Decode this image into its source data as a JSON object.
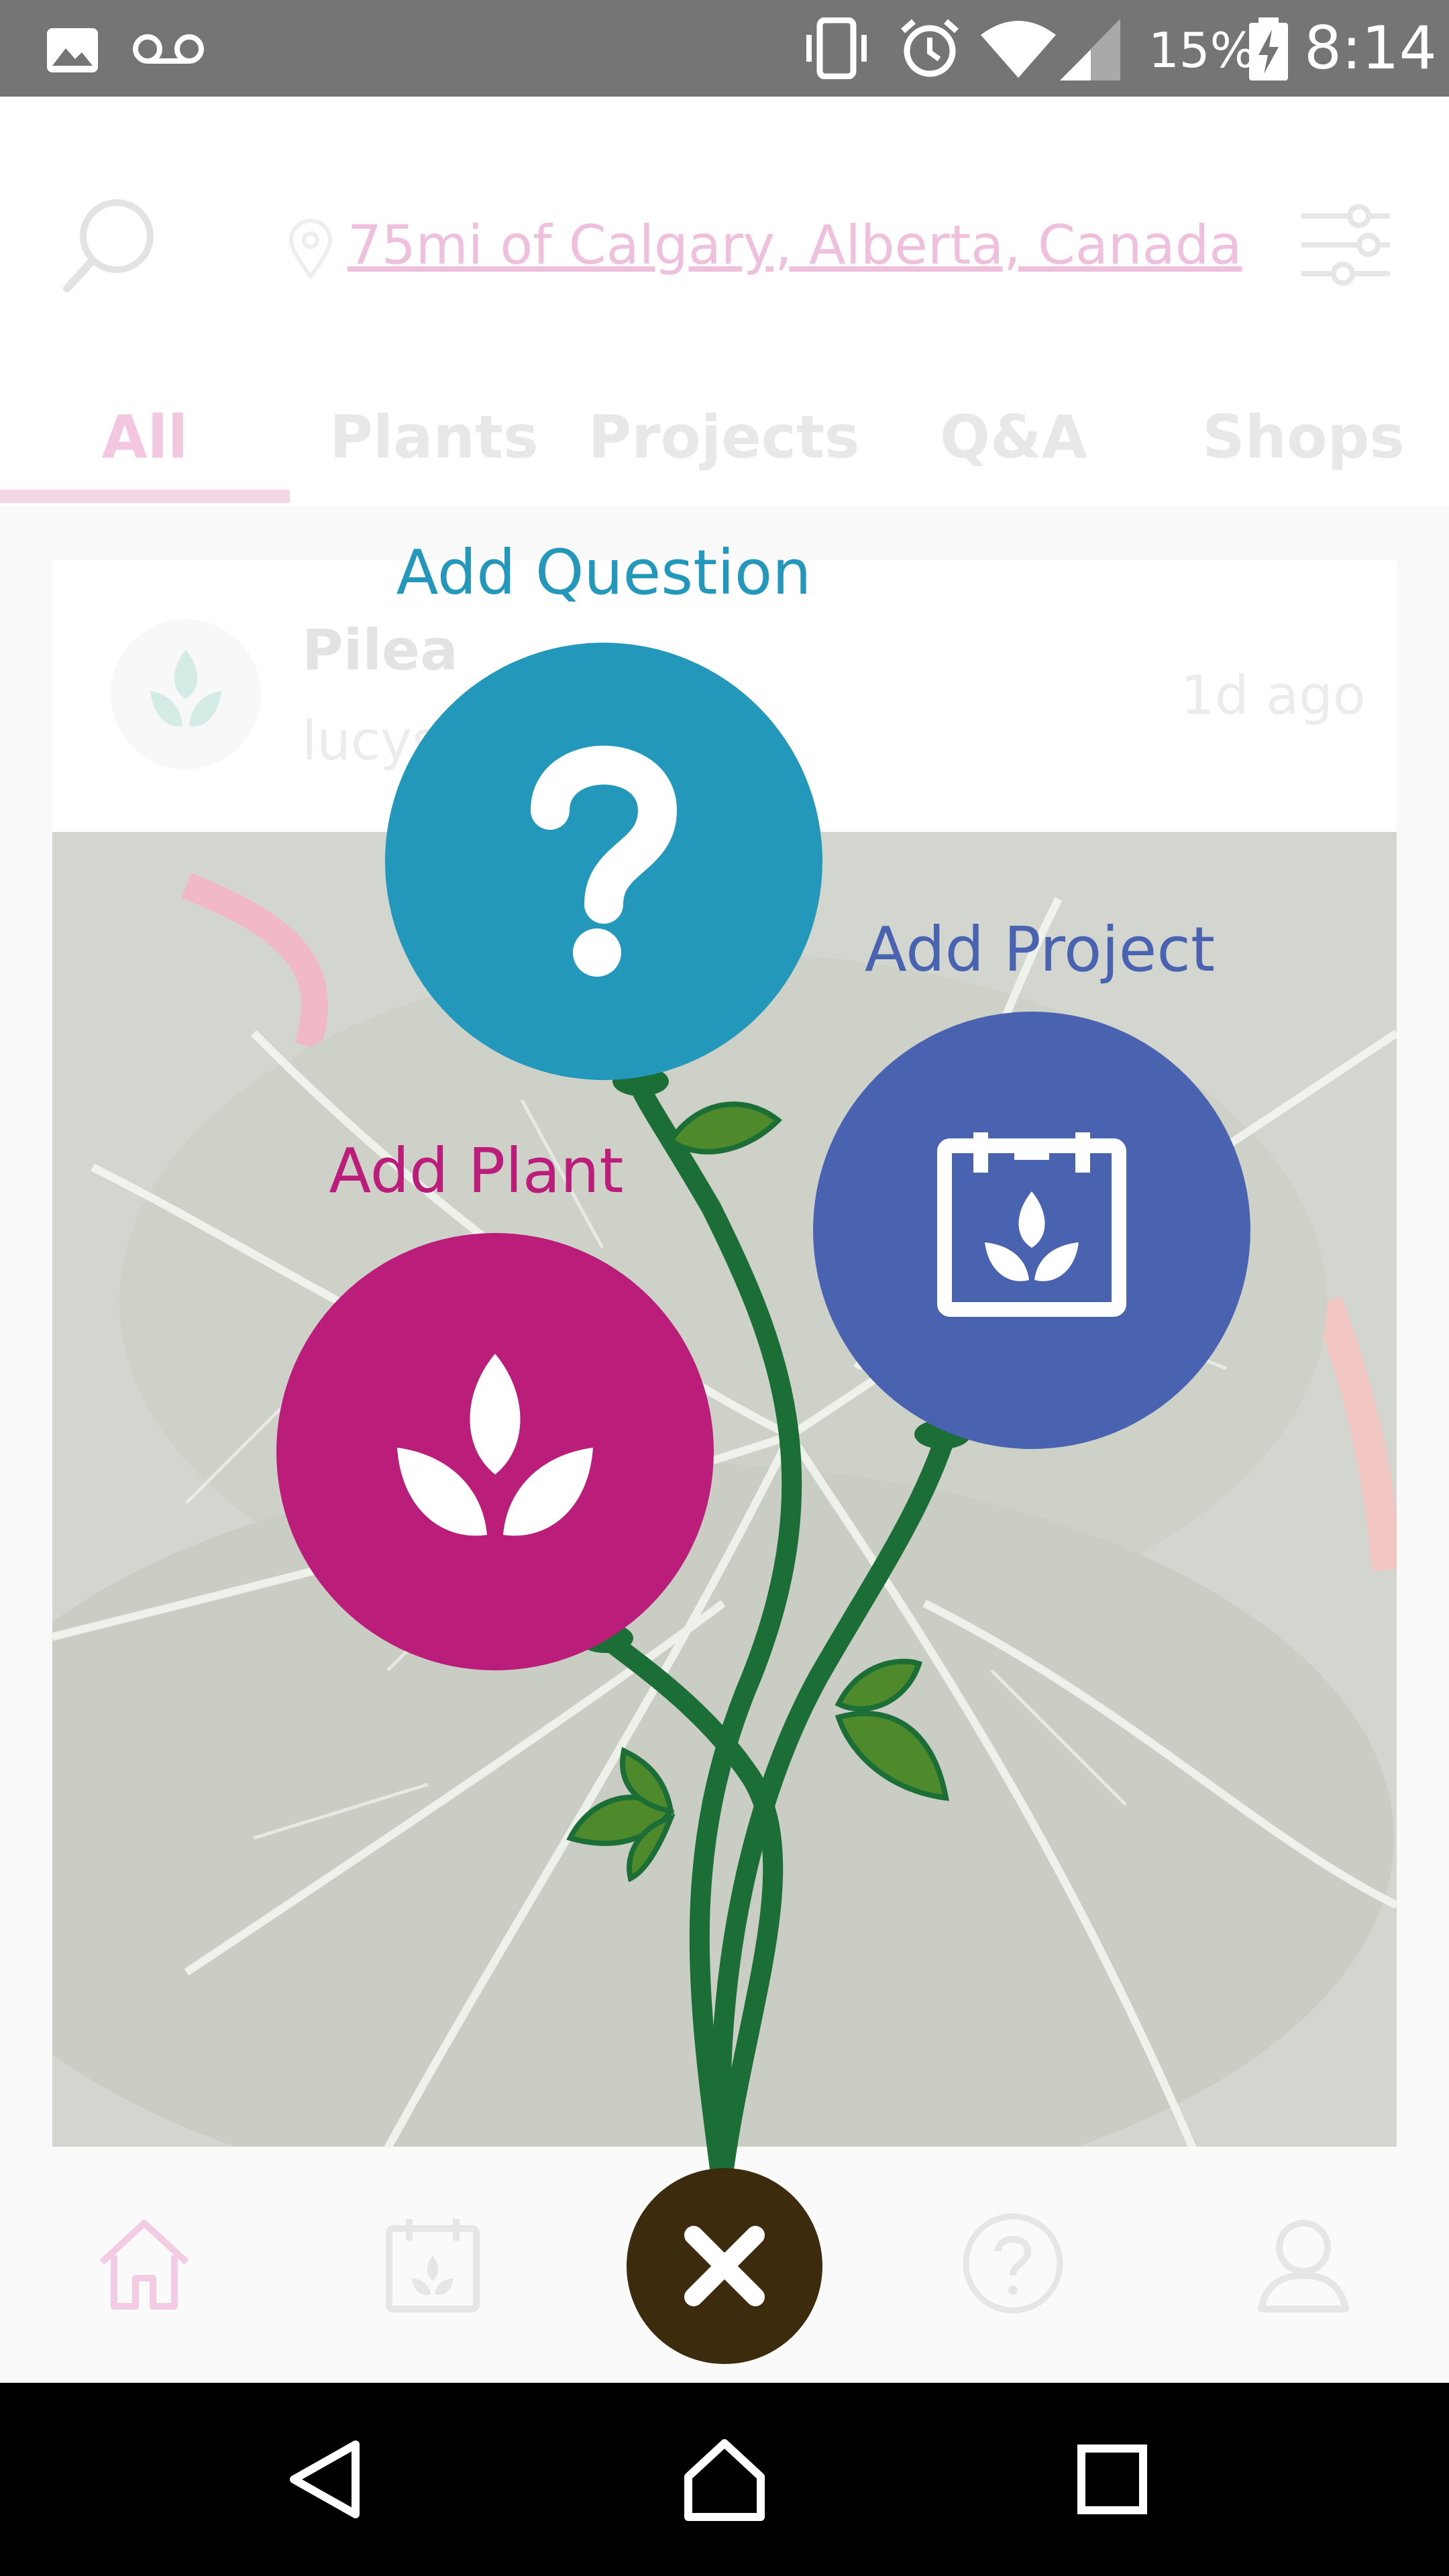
{
  "status_bar": {
    "battery": "15%",
    "time": "8:14",
    "icons": [
      "image-icon",
      "voicemail-icon",
      "vibrate-icon",
      "alarm-icon",
      "wifi-icon",
      "signal-icon",
      "battery-charging-icon"
    ]
  },
  "header": {
    "search_icon": "search-icon",
    "location_text": "75mi of Calgary, Alberta, Canada",
    "filter_icon": "sliders-icon"
  },
  "tabs": [
    {
      "label": "All",
      "active": true
    },
    {
      "label": "Plants",
      "active": false
    },
    {
      "label": "Projects",
      "active": false
    },
    {
      "label": "Q&A",
      "active": false
    },
    {
      "label": "Shops",
      "active": false
    }
  ],
  "post": {
    "title": "Pilea",
    "author": "lucys",
    "time": "1d ago"
  },
  "actions": {
    "question": {
      "label": "Add Question",
      "color": "#2498bb"
    },
    "project": {
      "label": "Add Project",
      "color": "#4a63b0"
    },
    "plant": {
      "label": "Add Plant",
      "color": "#bb1d7a"
    },
    "close": {
      "icon": "close-icon",
      "color": "#3d2b0e"
    }
  },
  "bottom_nav": {
    "items": [
      "home-icon",
      "project-icon",
      "question-icon",
      "profile-icon"
    ]
  },
  "colors": {
    "accent_pink": "#e8b3d4",
    "stem_green": "#1b6e35",
    "leaf_green": "#4e8a2c"
  }
}
